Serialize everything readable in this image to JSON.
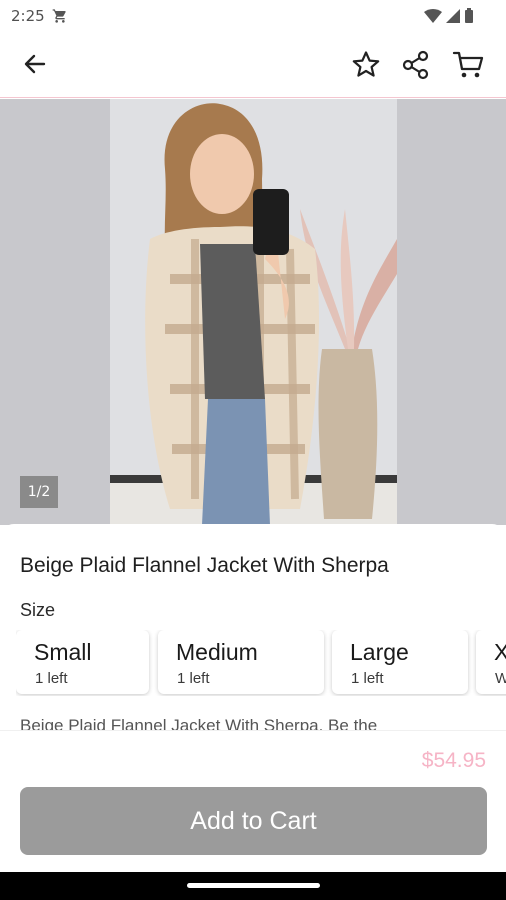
{
  "status_bar": {
    "time": "2:25",
    "icons": [
      "cart-notification-icon",
      "wifi-icon",
      "signal-icon",
      "battery-icon"
    ]
  },
  "app_bar": {
    "icons": [
      "back-arrow-icon",
      "star-icon",
      "share-icon",
      "cart-icon"
    ]
  },
  "gallery": {
    "counter": "1/2"
  },
  "product": {
    "title": "Beige Plaid Flannel Jacket With Sherpa",
    "size_label": "Size",
    "sizes": [
      {
        "name": "Small",
        "stock": "1 left"
      },
      {
        "name": "Medium",
        "stock": "1 left"
      },
      {
        "name": "Large",
        "stock": "1 left"
      },
      {
        "name": "X",
        "stock": "W"
      }
    ],
    "description": "Beige Plaid Flannel Jacket With Sherpa. Be the",
    "price": "$54.95",
    "add_to_cart_label": "Add to Cart"
  },
  "colors": {
    "accent_pink": "#f6b4c6",
    "button_gray": "#9b9b9b"
  }
}
